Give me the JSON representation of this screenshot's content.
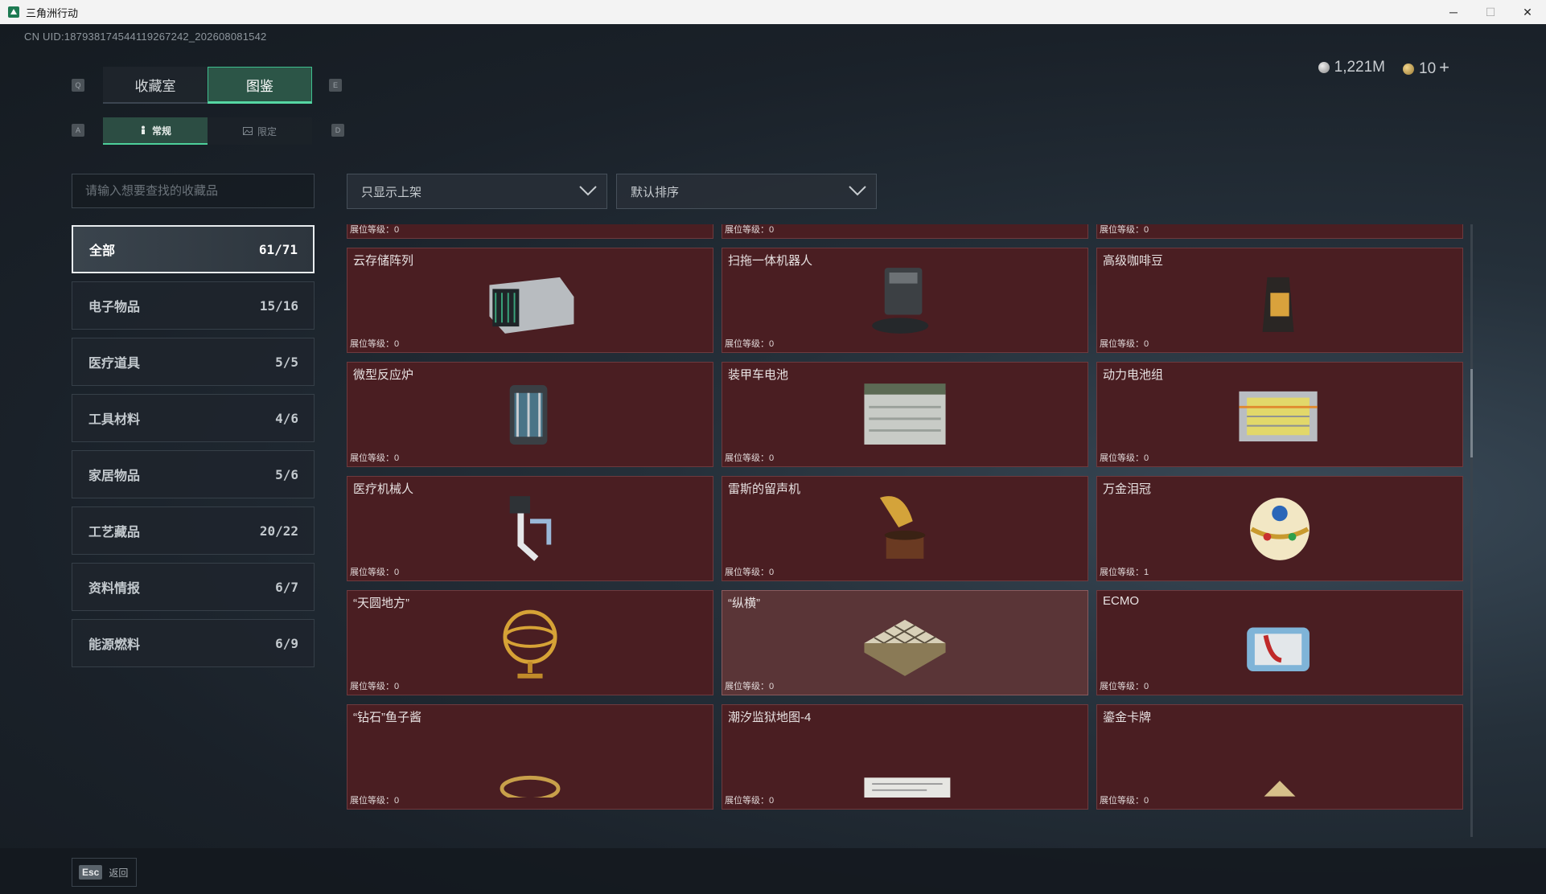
{
  "window": {
    "title": "三角洲行动",
    "minimize": "─",
    "maximize": "☐",
    "close": "✕"
  },
  "uid": "CN UID:1879381745441192672​42_202608081542",
  "currency": {
    "silver": "1,221M",
    "gold": "10",
    "plus": "+"
  },
  "keys": {
    "q": "Q",
    "e": "E",
    "a": "A",
    "d": "D"
  },
  "top_tabs": [
    {
      "label": "收藏室",
      "active": false
    },
    {
      "label": "图鉴",
      "active": true
    }
  ],
  "sub_tabs": [
    {
      "label": "常规",
      "icon": "figure-icon",
      "active": true
    },
    {
      "label": "限定",
      "icon": "image-icon",
      "active": false
    }
  ],
  "search": {
    "placeholder": "请输入想要查找的收藏品"
  },
  "filters": {
    "shelf": "只显示上架",
    "sort": "默认排序"
  },
  "categories": [
    {
      "name": "全部",
      "count": "61/71"
    },
    {
      "name": "电子物品",
      "count": "15/16"
    },
    {
      "name": "医疗道具",
      "count": "5/5"
    },
    {
      "name": "工具材料",
      "count": "4/6"
    },
    {
      "name": "家居物品",
      "count": "5/6"
    },
    {
      "name": "工艺藏品",
      "count": "20/22"
    },
    {
      "name": "资料情报",
      "count": "6/7"
    },
    {
      "name": "能源燃料",
      "count": "6/9"
    }
  ],
  "level_label": "展位等级：",
  "items": [
    {
      "name": "",
      "level": "0",
      "icon": "fuel-can-icon"
    },
    {
      "name": "",
      "level": "0",
      "icon": "terminal-icon"
    },
    {
      "name": "",
      "level": "0",
      "icon": "vacuum-icon"
    },
    {
      "name": "云存储阵列",
      "level": "0",
      "icon": "storage-array-icon"
    },
    {
      "name": "扫拖一体机器人",
      "level": "0",
      "icon": "robot-vacuum-icon"
    },
    {
      "name": "高级咖啡豆",
      "level": "0",
      "icon": "coffee-bag-icon"
    },
    {
      "name": "微型反应炉",
      "level": "0",
      "icon": "reactor-icon"
    },
    {
      "name": "装甲车电池",
      "level": "0",
      "icon": "battery-icon"
    },
    {
      "name": "动力电池组",
      "level": "0",
      "icon": "battery-pack-icon"
    },
    {
      "name": "医疗机械人",
      "level": "0",
      "icon": "medical-robot-icon"
    },
    {
      "name": "雷斯的留声机",
      "level": "0",
      "icon": "gramophone-icon"
    },
    {
      "name": "万金泪冠",
      "level": "1",
      "icon": "jeweled-egg-icon"
    },
    {
      "name": "“天圆地方”",
      "level": "0",
      "icon": "armillary-icon"
    },
    {
      "name": "“纵横”",
      "level": "0",
      "icon": "chessboard-icon"
    },
    {
      "name": "ECMO",
      "level": "0",
      "icon": "ecmo-icon"
    },
    {
      "name": "“钻石”鱼子酱",
      "level": "0",
      "icon": "caviar-icon"
    },
    {
      "name": "潮汐监狱地图-4",
      "level": "0",
      "icon": "map-icon"
    },
    {
      "name": "鎏金卡牌",
      "level": "0",
      "icon": "gold-card-icon"
    }
  ],
  "footer": {
    "esc_key": "Esc",
    "back_label": "返回"
  },
  "colors": {
    "accent": "#4dcf9a",
    "card_bg": "#4a1e22",
    "card_hover_bg": "#5a3537"
  }
}
